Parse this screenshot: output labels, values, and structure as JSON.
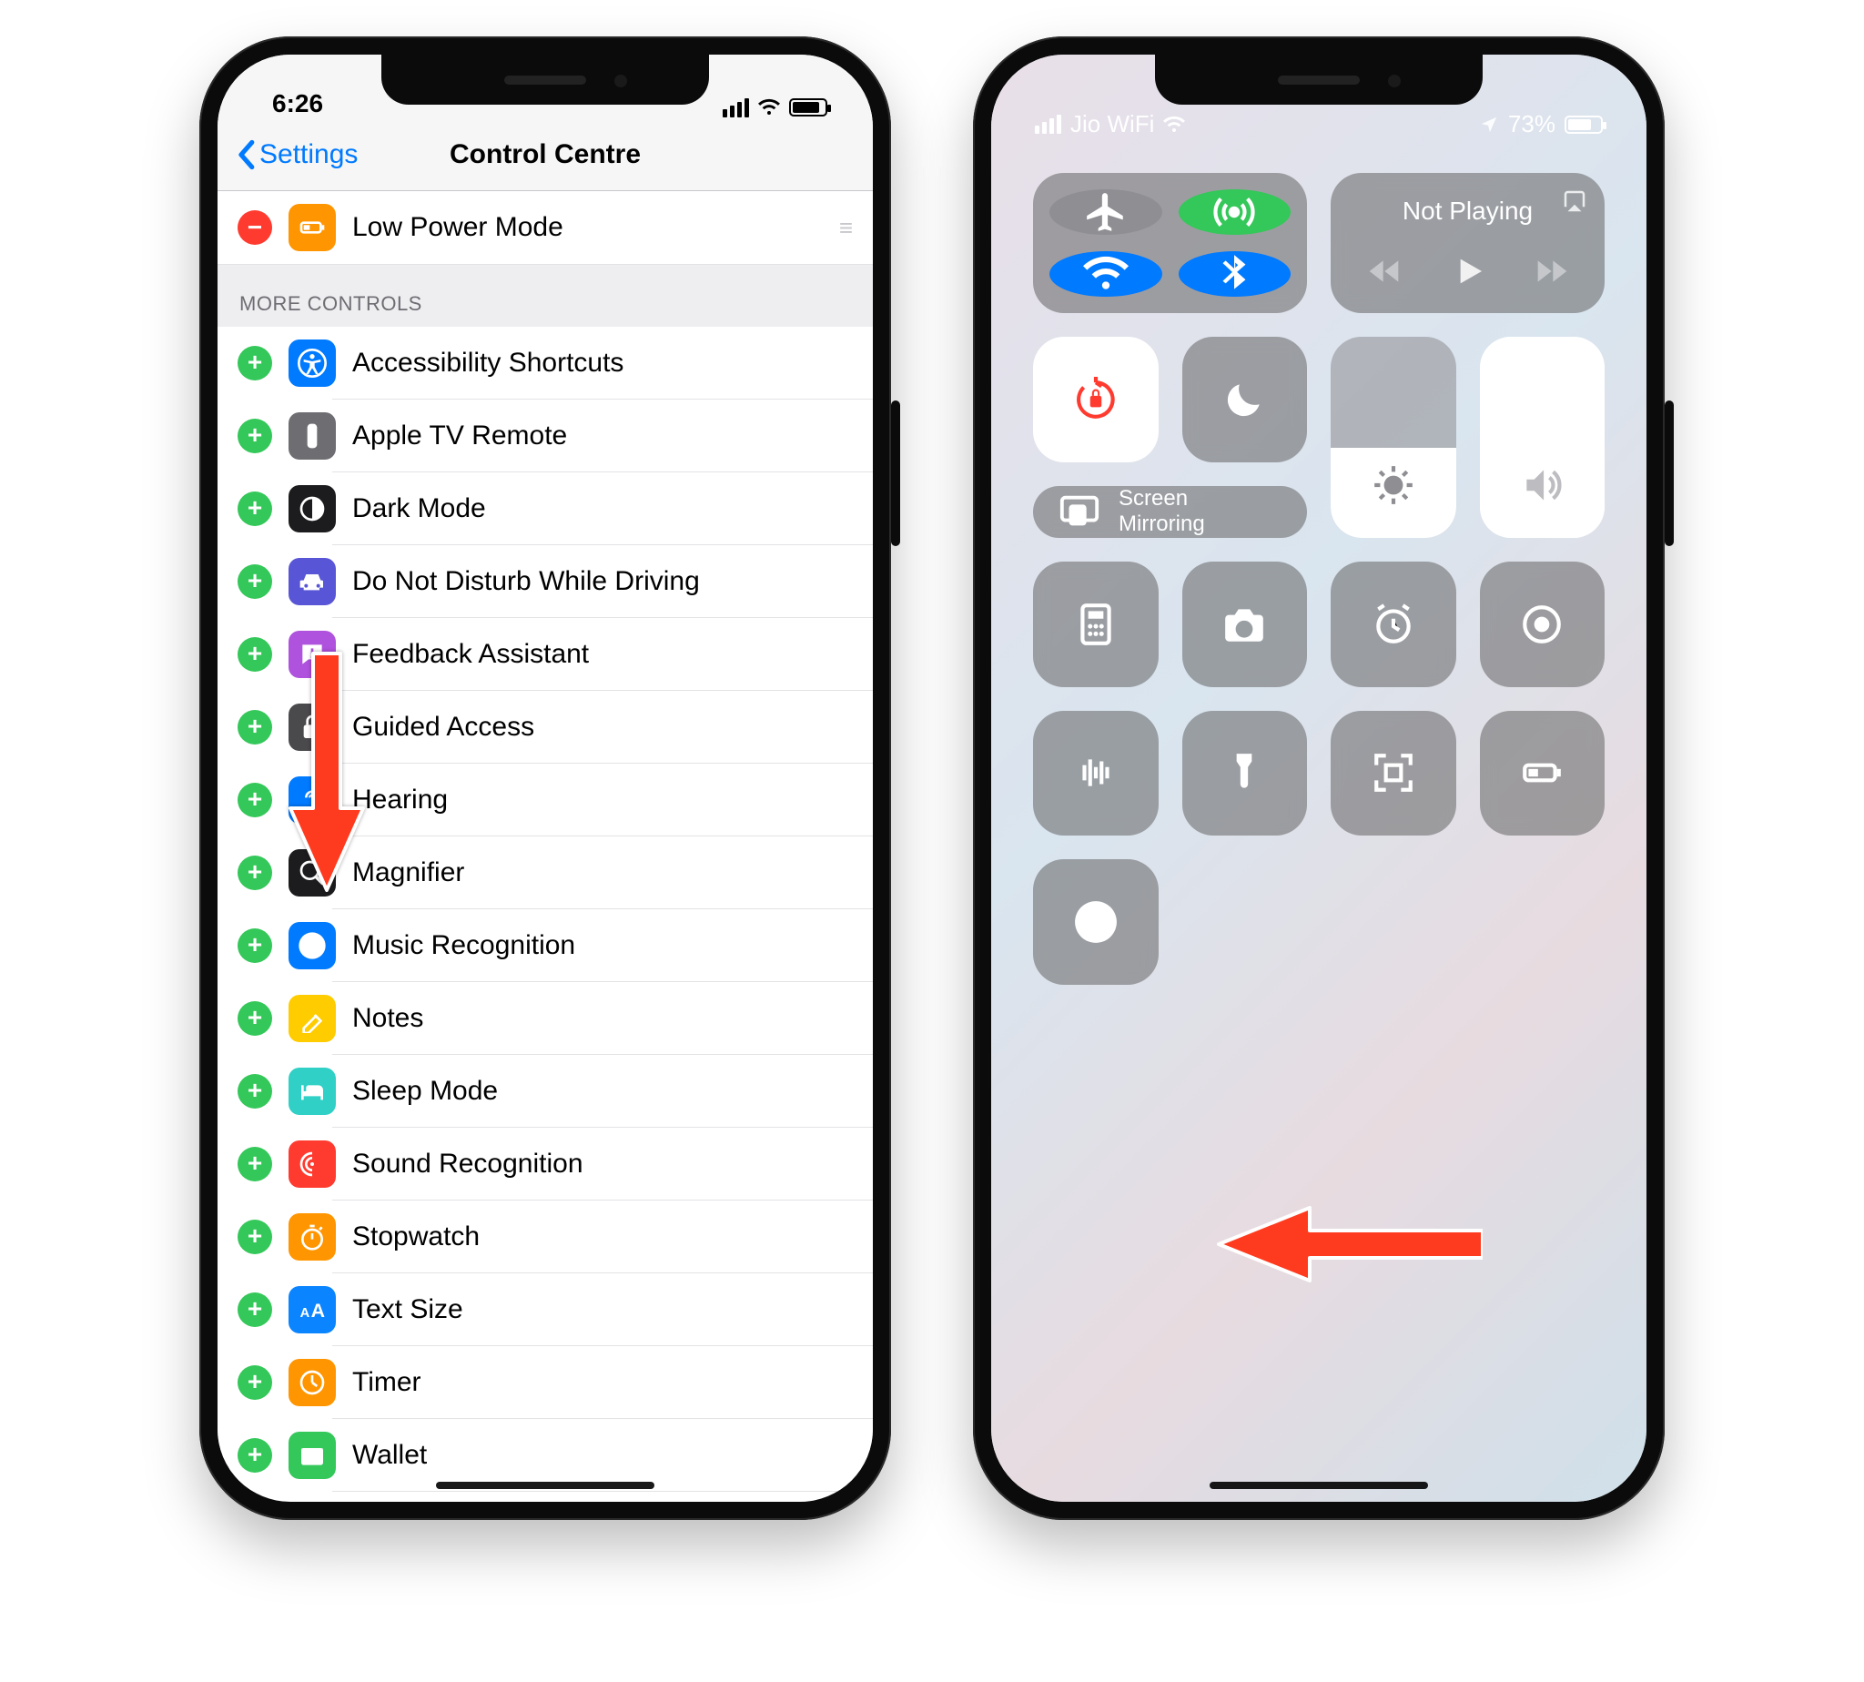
{
  "left": {
    "status": {
      "time": "6:26"
    },
    "nav": {
      "back": "Settings",
      "title": "Control Centre"
    },
    "included": [
      {
        "id": "low-power",
        "label": "Low Power Mode",
        "icon_bg": "#ff9500",
        "icon_svg": "battery"
      }
    ],
    "section_header": "MORE CONTROLS",
    "more": [
      {
        "id": "accessibility-shortcuts",
        "label": "Accessibility Shortcuts",
        "icon_bg": "#007aff",
        "icon_svg": "accessibility"
      },
      {
        "id": "apple-tv-remote",
        "label": "Apple TV Remote",
        "icon_bg": "#6d6d72",
        "icon_svg": "remote"
      },
      {
        "id": "dark-mode",
        "label": "Dark Mode",
        "icon_bg": "#1c1c1e",
        "icon_svg": "darkmode"
      },
      {
        "id": "dnd-driving",
        "label": "Do Not Disturb While Driving",
        "icon_bg": "#5856d6",
        "icon_svg": "car"
      },
      {
        "id": "feedback-assistant",
        "label": "Feedback Assistant",
        "icon_bg": "#af52de",
        "icon_svg": "feedback"
      },
      {
        "id": "guided-access",
        "label": "Guided Access",
        "icon_bg": "#4a4a4d",
        "icon_svg": "lock"
      },
      {
        "id": "hearing",
        "label": "Hearing",
        "icon_bg": "#007aff",
        "icon_svg": "ear"
      },
      {
        "id": "magnifier",
        "label": "Magnifier",
        "icon_bg": "#1c1c1e",
        "icon_svg": "magnifier"
      },
      {
        "id": "music-recognition",
        "label": "Music Recognition",
        "icon_bg": "#007aff",
        "icon_svg": "shazam"
      },
      {
        "id": "notes",
        "label": "Notes",
        "icon_bg": "#ffcc00",
        "icon_svg": "notes"
      },
      {
        "id": "sleep-mode",
        "label": "Sleep Mode",
        "icon_bg": "#30d0c6",
        "icon_svg": "bed"
      },
      {
        "id": "sound-recognition",
        "label": "Sound Recognition",
        "icon_bg": "#ff3b30",
        "icon_svg": "wave"
      },
      {
        "id": "stopwatch",
        "label": "Stopwatch",
        "icon_bg": "#ff9500",
        "icon_svg": "stopwatch"
      },
      {
        "id": "text-size",
        "label": "Text Size",
        "icon_bg": "#0a84ff",
        "icon_svg": "textsize"
      },
      {
        "id": "timer",
        "label": "Timer",
        "icon_bg": "#ff9500",
        "icon_svg": "timer"
      },
      {
        "id": "wallet",
        "label": "Wallet",
        "icon_bg": "#34c759",
        "icon_svg": "wallet"
      }
    ]
  },
  "right": {
    "status": {
      "carrier": "Jio WiFi",
      "battery": "73%"
    },
    "media_title": "Not Playing",
    "screen_mirroring": "Screen\nMirroring",
    "brightness_pct": 45,
    "volume_pct": 100
  }
}
